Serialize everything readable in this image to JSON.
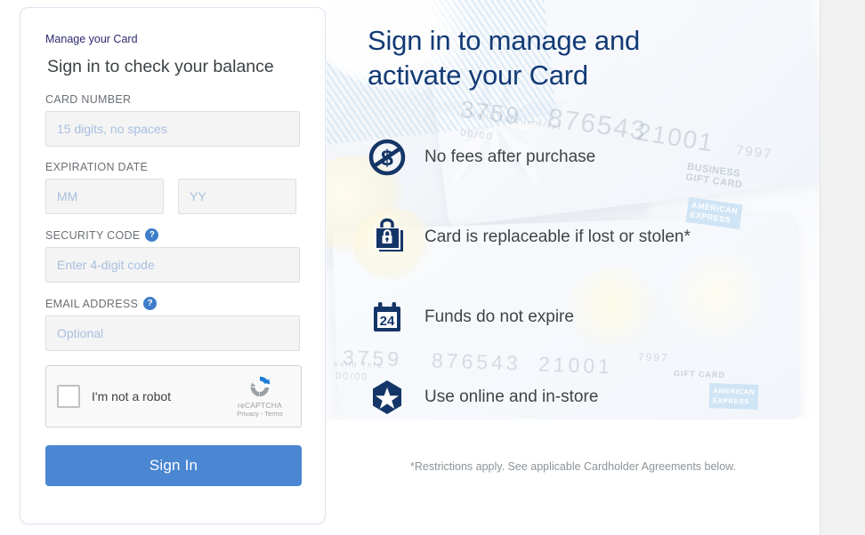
{
  "signin_card": {
    "brand_link": "Manage your Card",
    "title": "Sign in to check your balance",
    "fields": {
      "card_number": {
        "label": "CARD NUMBER",
        "placeholder": "15 digits, no spaces",
        "value": ""
      },
      "expiration": {
        "label": "EXPIRATION DATE",
        "month": {
          "placeholder": "MM",
          "value": ""
        },
        "year": {
          "placeholder": "YY",
          "value": ""
        }
      },
      "security_code": {
        "label": "SECURITY CODE",
        "help": "?",
        "placeholder": "Enter 4-digit code",
        "value": ""
      },
      "email": {
        "label": "EMAIL ADDRESS",
        "help": "?",
        "placeholder": "Optional",
        "value": ""
      }
    },
    "recaptcha": {
      "checkbox_label": "I'm not a robot",
      "brand": "reCAPTCHA",
      "legal": "Privacy - Terms"
    },
    "submit_label": "Sign In"
  },
  "hero": {
    "title": "Sign in to manage and activate your Card",
    "features": [
      {
        "icon": "no-fees-icon",
        "text": "No fees after purchase"
      },
      {
        "icon": "lock-bag-icon",
        "text": "Card is replaceable if lost or stolen*"
      },
      {
        "icon": "calendar-24-icon",
        "text": "Funds do not expire"
      },
      {
        "icon": "star-badge-icon",
        "text": "Use online and in-store"
      }
    ],
    "note": "*Restrictions apply. See applicable Cardholder Agreements below.",
    "background": {
      "numbers": [
        "3759",
        "876543",
        "21001",
        "7997",
        "3759",
        "876543",
        "21001",
        "7997",
        "Valid Thru (mm/yy)",
        "00/00",
        "Valid Thru",
        "00/00"
      ],
      "labels": [
        "BUSINESS\nGIFT CARD",
        "GIFT CARD"
      ],
      "amex": [
        "AMERICAN\nEXPRESS",
        "AMERICAN\nEXPRESS"
      ]
    }
  },
  "colors": {
    "brand_navy": "#123a75",
    "icon_navy": "#143567",
    "button_blue": "#4a86d2",
    "help_blue": "#3d7dc9",
    "link_indigo": "#2b2a6e",
    "placeholder": "#a8bfe0"
  }
}
